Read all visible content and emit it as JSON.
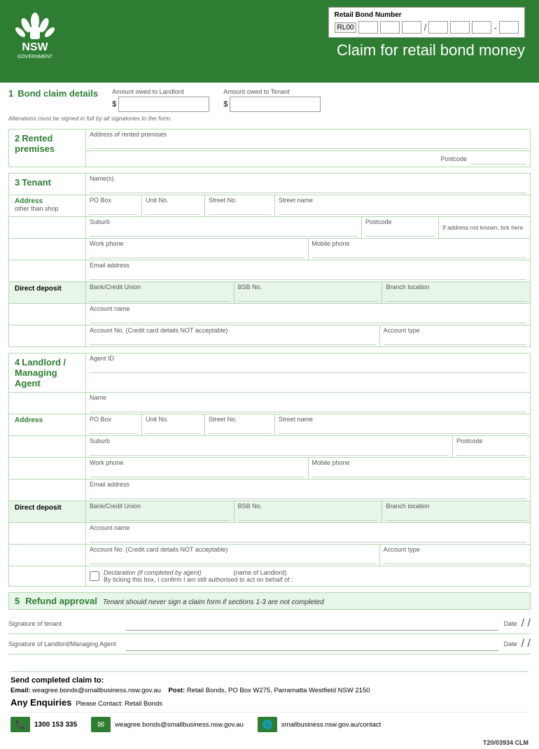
{
  "header": {
    "title": "Claim for retail bond money",
    "bond_number_label": "Retail Bond Number",
    "bond_prefix": "RL00",
    "logo_alt": "NSW Government"
  },
  "section1": {
    "number": "1",
    "title": "Bond claim details",
    "amount_landlord_label": "Amount owed to Landlord",
    "amount_tenant_label": "Amount owed to Tenant",
    "currency": "$",
    "alterations_note": "Alterations must be signed in full by all signatories to the form."
  },
  "section2": {
    "number": "2",
    "title": "Rented premises",
    "address_label": "Address of rented premises",
    "postcode_label": "Postcode"
  },
  "section3": {
    "number": "3",
    "title": "Tenant",
    "names_label": "Name(s)",
    "address_label": "Address",
    "address_sub": "other than shop",
    "po_box_label": "PO Box",
    "unit_no_label": "Unit No.",
    "street_no_label": "Street No.",
    "street_name_label": "Street name",
    "suburb_label": "Suburb",
    "postcode_label": "Postcode",
    "address_not_known_label": "If address not known, tick here",
    "work_phone_label": "Work phone",
    "mobile_phone_label": "Mobile phone",
    "email_label": "Email address",
    "direct_deposit_label": "Direct deposit",
    "bank_label": "Bank/Credit Union",
    "bsb_label": "BSB No.",
    "branch_label": "Branch location",
    "account_name_label": "Account name",
    "account_no_label": "Account No. (Credit card details NOT acceptable)",
    "account_type_label": "Account type"
  },
  "section4": {
    "number": "4",
    "title": "Landlord / Managing Agent",
    "agent_id_label": "Agent ID",
    "name_label": "Name",
    "address_label": "Address",
    "po_box_label": "PO Box",
    "unit_no_label": "Unit No.",
    "street_no_label": "Street No.",
    "street_name_label": "Street name",
    "suburb_label": "Suburb",
    "postcode_label": "Postcode",
    "work_phone_label": "Work phone",
    "mobile_phone_label": "Mobile phone",
    "email_label": "Email address",
    "direct_deposit_label": "Direct deposit",
    "bank_label": "Bank/Credit Union",
    "bsb_label": "BSB No.",
    "branch_label": "Branch location",
    "account_name_label": "Account name",
    "account_no_label": "Account No. (Credit card details NOT acceptable)",
    "account_type_label": "Account type",
    "declaration_label": "Declaration (if completed by agent)",
    "declaration_text": "By ticking this box, I confirm I am still authorised to act on behalf of :",
    "name_of_landlord_label": "(name of Landlord)"
  },
  "section5": {
    "number": "5",
    "title": "Refund approval",
    "warning": "Tenant should never sign a claim form if sections 1-3 are not completed",
    "sig_tenant_label": "Signature of tenant",
    "sig_landlord_label": "Signature of Landlord/Managing Agent",
    "date_label": "Date"
  },
  "footer": {
    "send_title": "Send completed claim to:",
    "email_label": "Email:",
    "email_value": "weagree.bonds@smallbusiness.nsw.gov.au",
    "post_label": "Post:",
    "post_value": "Retail Bonds, PO Box W275, Parramatta Westfield NSW 2150",
    "enquiries_label": "Any Enquiries",
    "enquiries_text": "Please Contact: Retail Bonds",
    "phone": "1300 153 335",
    "contact_email": "weagree.bonds@smallbusiness.nsw.gov.au",
    "contact_web": "smallbusiness.nsw.gov.au/contact",
    "form_code": "T20/03934 CLM"
  }
}
